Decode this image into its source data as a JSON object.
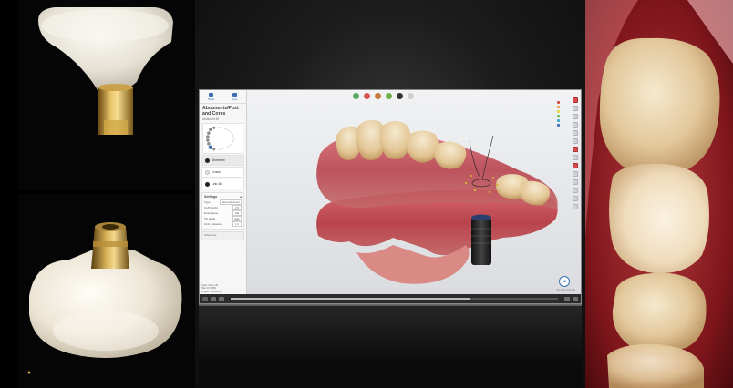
{
  "app": {
    "panel_title": "Abutments/Post and Cores",
    "panel_subtitle": "Abutment 46",
    "header_buttons": [
      {
        "label": "Back",
        "icon": "back-icon"
      },
      {
        "label": "Next",
        "icon": "next-icon"
      }
    ],
    "steps": [
      {
        "label": "Abutment",
        "state": "active"
      },
      {
        "label": "Crown",
        "state": "inactive"
      },
      {
        "label": "Link 46",
        "state": "inactive"
      }
    ],
    "settings": {
      "title": "Settings",
      "rows": [
        {
          "label": "Type",
          "value": "Mono-abutment"
        },
        {
          "label": "Cuff height",
          "value": "0.5"
        },
        {
          "label": "Emergence",
          "value": "Std"
        },
        {
          "label": "Tip angle",
          "value": "Auto"
        },
        {
          "label": "Occl. distance",
          "value": "1.0"
        }
      ]
    },
    "advanced_label": "Advanced",
    "footer_lines": [
      "Case: Demo 46",
      "Site: 46 (LR6)",
      "Implant: Conical 4.0"
    ],
    "brand_badge": "3M",
    "view_hint": "Top view   Ctrl+Tab"
  },
  "colors": {
    "accent": "#3a6fb5",
    "gingiva": "#c9616a",
    "tooth": "#ead7b2",
    "implant": "#2a2a2a",
    "intraoral": "#6b0f12"
  },
  "video": {
    "progress": 0.73
  },
  "photos": {
    "top_left": "Zirconia crown on gold Ti-base",
    "bottom_left": "Screw-retained crown, gold Ti-base",
    "right": "Intraoral photo of seated implant crown"
  }
}
